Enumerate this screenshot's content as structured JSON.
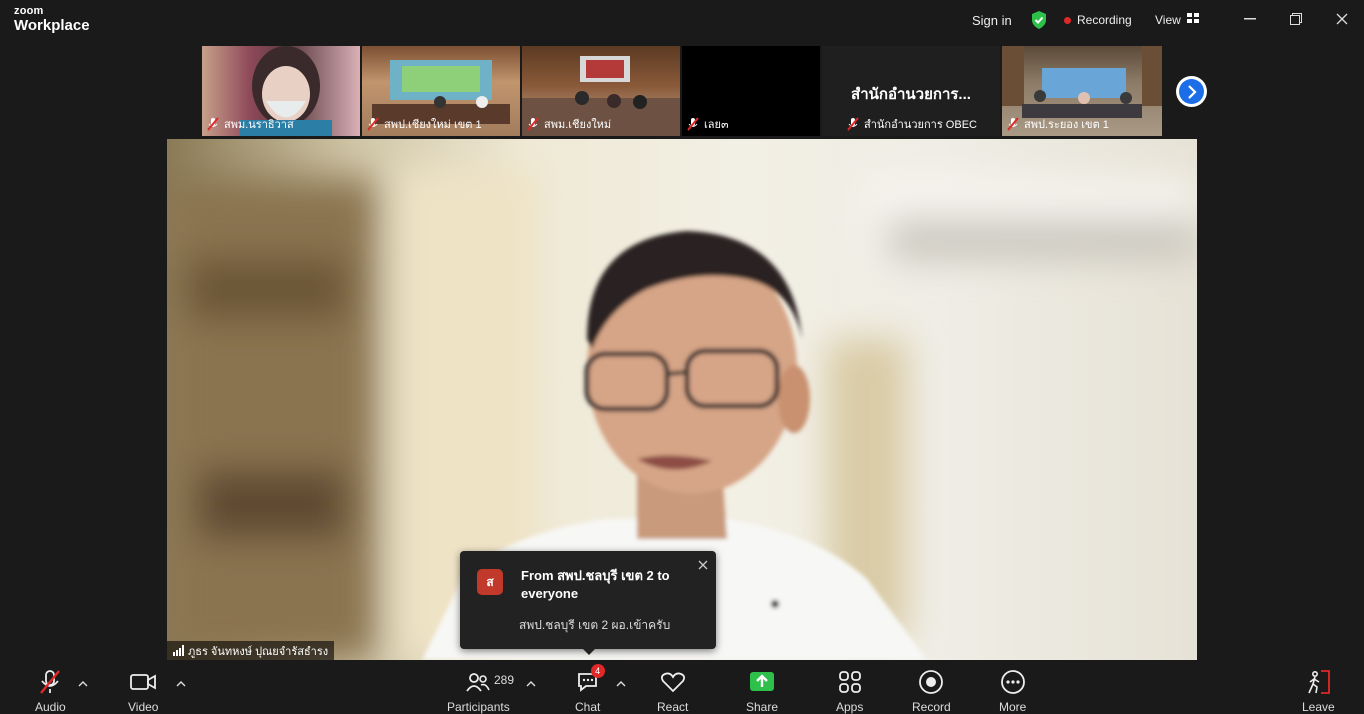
{
  "app": {
    "logo_top": "zoom",
    "logo_bottom": "Workplace"
  },
  "titlebar": {
    "sign_in": "Sign in",
    "recording": "Recording",
    "view": "View"
  },
  "thumbnails": [
    {
      "name": "สพม.นราธิวาส"
    },
    {
      "name": "สพป.เชียงใหม่ เขต 1"
    },
    {
      "name": "สพม.เชียงใหม่"
    },
    {
      "name": "เลย๓"
    },
    {
      "name": "สำนักอำนวยการ OBEC",
      "big_name": "สำนักอำนวยการ..."
    },
    {
      "name": "สพป.ระยอง เขต 1"
    }
  ],
  "speaker": {
    "name": "ภูธร จันทหงษ์ ปุณยจำรัสธำรง"
  },
  "chat_toast": {
    "avatar_letter": "ส",
    "from": "From สพป.ชลบุรี เขต 2 to everyone",
    "message": "สพป.ชลบุรี  เขต  2  ผอ.เข้าครับ"
  },
  "toolbar": {
    "audio": "Audio",
    "video": "Video",
    "participants": "Participants",
    "participants_count": "289",
    "chat": "Chat",
    "chat_badge": "4",
    "react": "React",
    "share": "Share",
    "apps": "Apps",
    "record": "Record",
    "more": "More",
    "leave": "Leave"
  },
  "colors": {
    "background": "#1a1a1a",
    "recording_dot": "#e02828",
    "share_green": "#2ec04a",
    "next_blue": "#1b6ee8",
    "shield_green": "#2ec04a"
  }
}
